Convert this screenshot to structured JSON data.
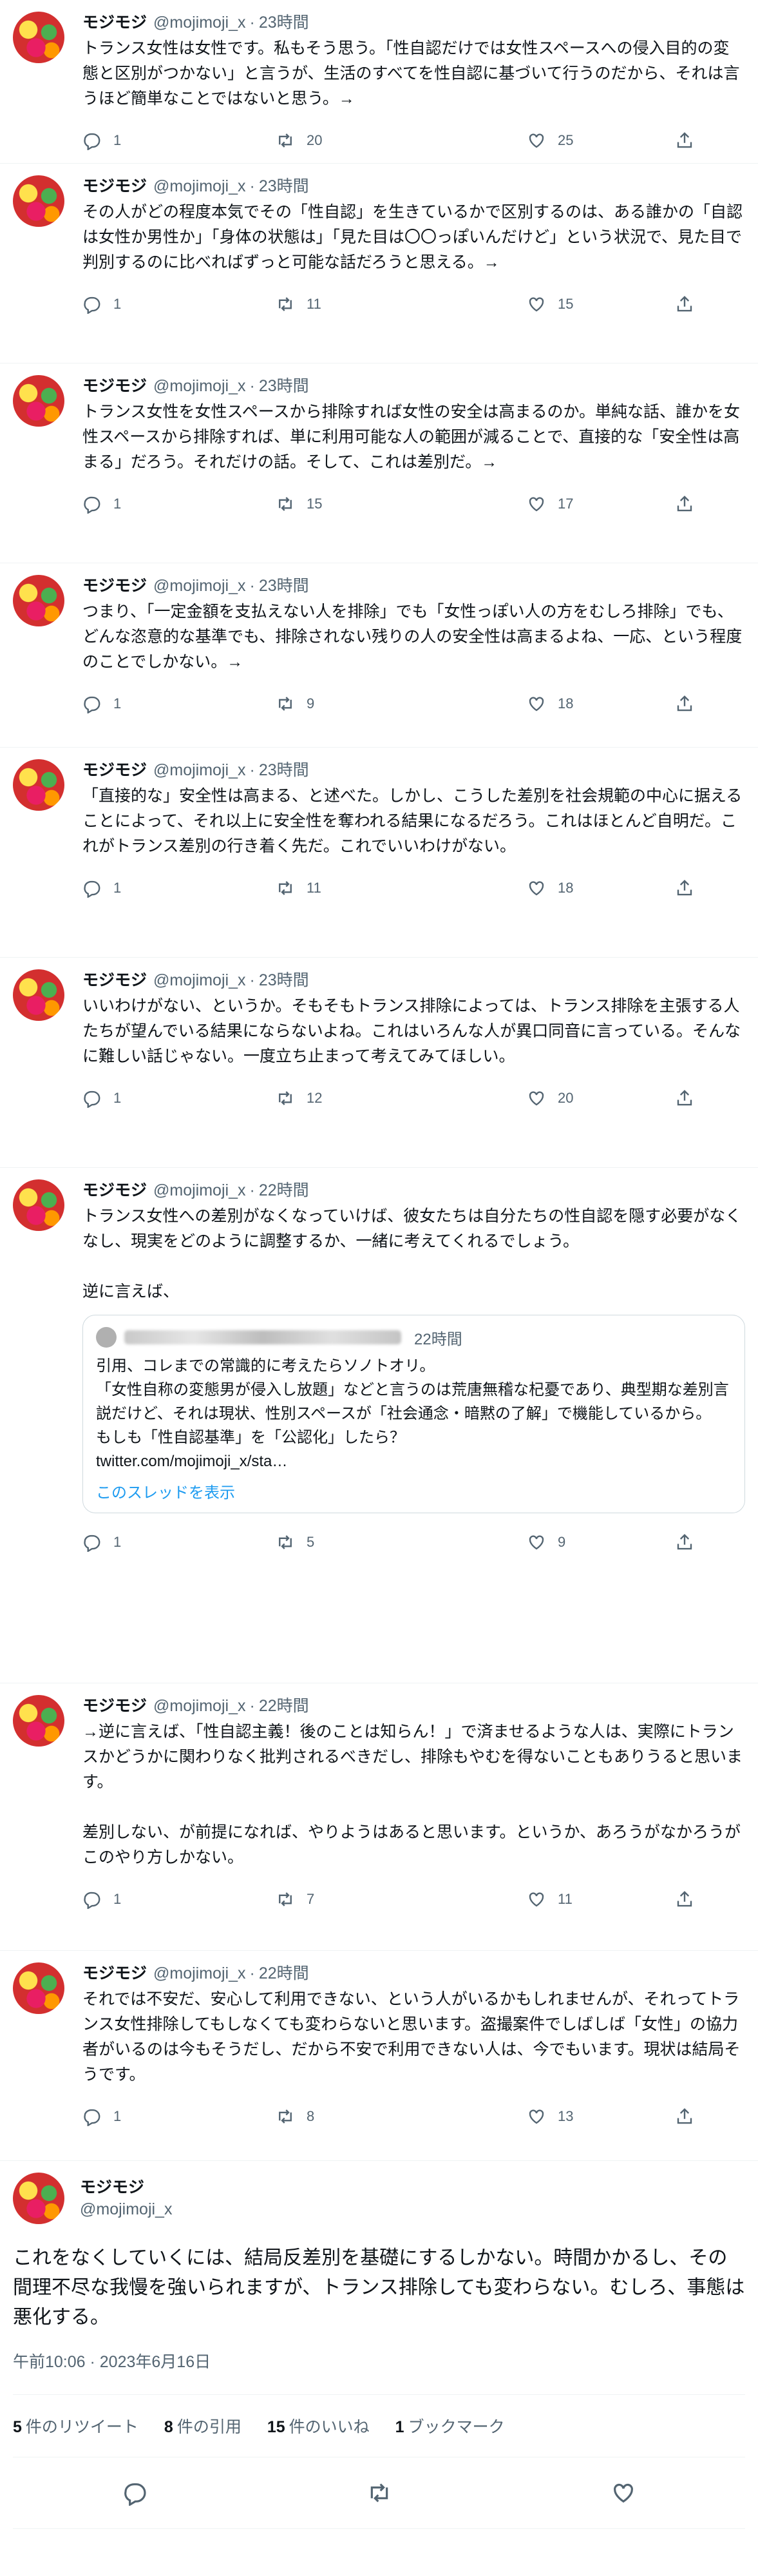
{
  "author": {
    "name": "モジモジ",
    "handle": "@mojimoji_x"
  },
  "separator": "·",
  "tweets": [
    {
      "time": "23時間",
      "text": "トランス女性は女性です。私もそう思う。「性自認だけでは女性スペースへの侵入目的の変態と区別がつかない」と言うが、生活のすべてを性自認に基づいて行うのだから、それは言うほど簡単なことではないと思う。→",
      "replies": "1",
      "retweets": "20",
      "likes": "25"
    },
    {
      "time": "23時間",
      "text": "その人がどの程度本気でその「性自認」を生きているかで区別するのは、ある誰かの「自認は女性か男性か」「身体の状態は」「見た目は〇〇っぽいんだけど」という状況で、見た目で判別するのに比べればずっと可能な話だろうと思える。→",
      "replies": "1",
      "retweets": "11",
      "likes": "15"
    },
    {
      "time": "23時間",
      "text": "トランス女性を女性スペースから排除すれば女性の安全は高まるのか。単純な話、誰かを女性スペースから排除すれば、単に利用可能な人の範囲が減ることで、直接的な「安全性は高まる」だろう。それだけの話。そして、これは差別だ。→",
      "replies": "1",
      "retweets": "15",
      "likes": "17"
    },
    {
      "time": "23時間",
      "text": "つまり、「一定金額を支払えない人を排除」でも「女性っぽい人の方をむしろ排除」でも、どんな恣意的な基準でも、排除されない残りの人の安全性は高まるよね、一応、という程度のことでしかない。→",
      "replies": "1",
      "retweets": "9",
      "likes": "18"
    },
    {
      "time": "23時間",
      "text": "「直接的な」安全性は高まる、と述べた。しかし、こうした差別を社会規範の中心に据えることによって、それ以上に安全性を奪われる結果になるだろう。これはほとんど自明だ。これがトランス差別の行き着く先だ。これでいいわけがない。",
      "replies": "1",
      "retweets": "11",
      "likes": "18"
    },
    {
      "time": "23時間",
      "text": "いいわけがない、というか。そもそもトランス排除によっては、トランス排除を主張する人たちが望んでいる結果にならないよね。これはいろんな人が異口同音に言っている。そんなに難しい話じゃない。一度立ち止まって考えてみてほしい。",
      "replies": "1",
      "retweets": "12",
      "likes": "20"
    },
    {
      "time": "22時間",
      "text": "トランス女性への差別がなくなっていけば、彼女たちは自分たちの性自認を隠す必要がなくなし、現実をどのように調整するか、一緒に考えてくれるでしょう。\n\n逆に言えば、",
      "replies": "1",
      "retweets": "5",
      "likes": "9",
      "quote": {
        "time": "22時間",
        "text": "引用、コレまでの常識的に考えたらソノトオリ。\n「女性自称の変態男が侵入し放題」などと言うのは荒唐無稽な杞憂であり、典型期な差別言説だけど、それは現状、性別スペースが「社会通念・暗黙の了解」で機能しているから。\nもしも「性自認基準」を「公認化」したら？\ntwitter.com/mojimoji_x/sta…",
        "link": "このスレッドを表示"
      }
    },
    {
      "time": "22時間",
      "text": "→逆に言えば、「性自認主義！後のことは知らん！」で済ませるような人は、実際にトランスかどうかに関わりなく批判されるべきだし、排除もやむを得ないこともありうると思います。\n\n差別しない、が前提になれば、やりようはあると思います。というか、あろうがなかろうがこのやり方しかない。",
      "replies": "1",
      "retweets": "7",
      "likes": "11"
    },
    {
      "time": "22時間",
      "text": "それでは不安だ、安心して利用できない、という人がいるかもしれませんが、それってトランス女性排除してもしなくても変わらないと思います。盗撮案件でしばしば「女性」の協力者がいるのは今もそうだし、だから不安で利用できない人は、今でもいます。現状は結局そうです。",
      "replies": "1",
      "retweets": "8",
      "likes": "13"
    }
  ],
  "main_tweet": {
    "text": "これをなくしていくには、結局反差別を基礎にするしかない。時間かかるし、その間理不尽な我慢を強いられますが、トランス排除しても変わらない。むしろ、事態は悪化する。",
    "timestamp": "午前10:06 · 2023年6月16日",
    "stats": {
      "retweets_count": "5",
      "retweets_label": "件のリツイート",
      "quotes_count": "8",
      "quotes_label": "件の引用",
      "likes_count": "15",
      "likes_label": "件のいいね",
      "bookmarks_count": "1",
      "bookmarks_label": "ブックマーク"
    }
  }
}
